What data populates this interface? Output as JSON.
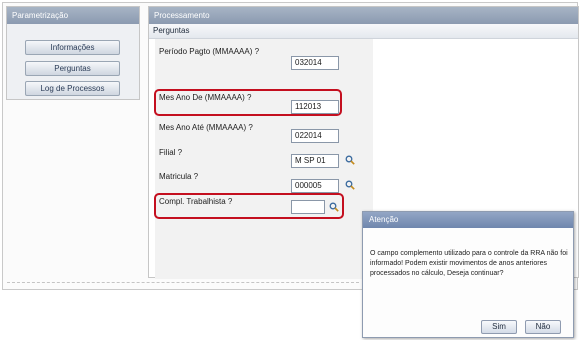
{
  "sidebar": {
    "header": "Parametrização",
    "items": [
      {
        "label": "Informações"
      },
      {
        "label": "Perguntas"
      },
      {
        "label": "Log de Processos"
      }
    ]
  },
  "main": {
    "header": "Processamento",
    "subheader": "Perguntas",
    "questions": [
      {
        "label": "Período Pagto (MMAAAA) ?",
        "value": "032014"
      },
      {
        "label": "Mes Ano De (MMAAAA) ?",
        "value": "112013"
      },
      {
        "label": "Mes Ano Até (MMAAAA) ?",
        "value": "022014"
      },
      {
        "label": "Filial ?",
        "value": "M SP 01"
      },
      {
        "label": "Matricula ?",
        "value": "000005"
      },
      {
        "label": "Compl. Trabalhista ?",
        "value": ""
      }
    ]
  },
  "dialog": {
    "title": "Atenção",
    "message": "O campo complemento utilizado para o controle da RRA não foi informado!  Podem existir movimentos de anos anteriores processados no cálculo, Deseja continuar?",
    "yes_label": "Sim",
    "no_label": "Não"
  },
  "colors": {
    "highlight": "#c40f1f",
    "header_blue": "#8b9ab0"
  }
}
